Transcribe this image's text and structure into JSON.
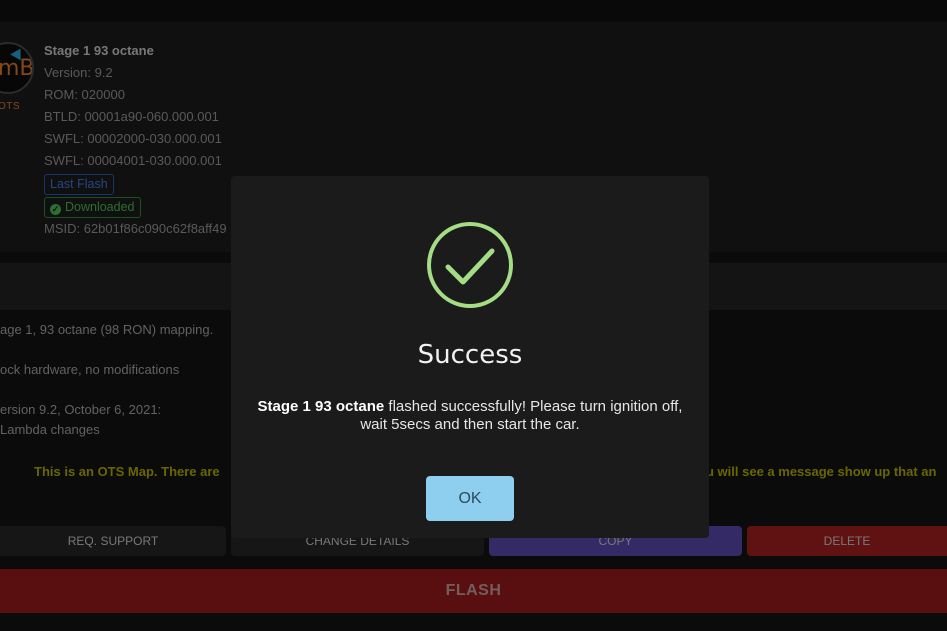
{
  "map": {
    "logo_tag": "OTS",
    "name": "Stage 1 93 octane",
    "version": "Version: 9.2",
    "rom": "ROM: 020000",
    "btld": "BTLD: 00001a90-060.000.001",
    "swfl1": "SWFL: 00002000-030.000.001",
    "swfl2": "SWFL: 00004001-030.000.001",
    "badge_last_flash": "Last Flash",
    "badge_downloaded": "Downloaded",
    "msid": "MSID: 62b01f86c090c62f8aff49"
  },
  "description": {
    "line1": "age 1, 93 octane (98 RON) mapping.",
    "line2": "ock hardware, no modifications",
    "line3": "ersion 9.2, October 6, 2021:",
    "line4": "Lambda changes"
  },
  "notice": {
    "left": "This is an OTS Map. There are",
    "right": "u will see a message show up that an"
  },
  "buttons": {
    "req_support": "REQ. SUPPORT",
    "change_details": "CHANGE DETAILS",
    "copy": "COPY",
    "delete": "DELETE",
    "flash": "FLASH"
  },
  "modal": {
    "title": "Success",
    "map_name": "Stage 1 93 octane",
    "message": " flashed successfully! Please turn ignition off, wait 5secs and then start the car.",
    "ok": "OK"
  },
  "colors": {
    "success_icon": "#a5dc86",
    "ok_button": "#8ecff0",
    "flash_button": "#9a1b1b",
    "copy_button": "#5a4bb0",
    "delete_button": "#a52020",
    "notice_text": "#b6b000"
  },
  "icons": {
    "success": "check-circle-icon",
    "downloaded": "check-circle-small-icon"
  }
}
